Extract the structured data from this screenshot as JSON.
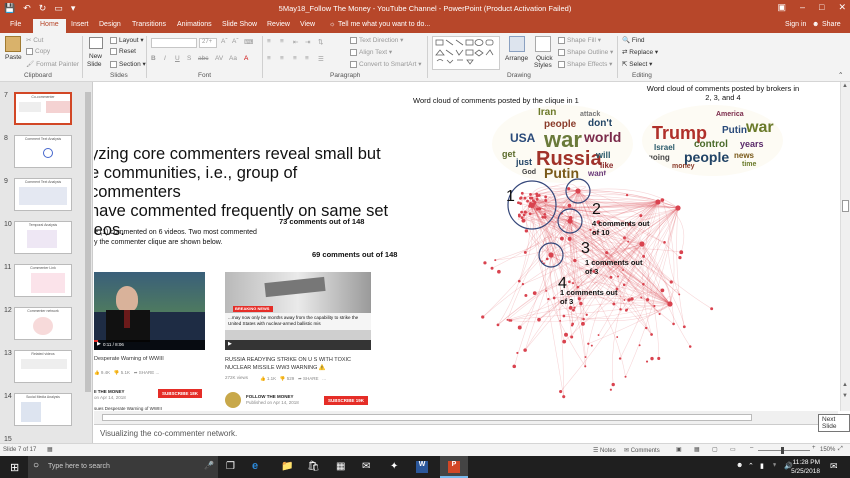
{
  "window": {
    "title": "5May18_Follow The Money - YouTube Channel - PowerPoint (Product Activation Failed)",
    "signin": "Sign in",
    "share": "Share"
  },
  "tabs": [
    "File",
    "Home",
    "Insert",
    "Design",
    "Transitions",
    "Animations",
    "Slide Show",
    "Review",
    "View"
  ],
  "tell_me": "Tell me what you want to do...",
  "ribbon": {
    "clipboard": {
      "paste": "Paste",
      "cut": "Cut",
      "copy": "Copy",
      "format_painter": "Format Painter",
      "label": "Clipboard"
    },
    "slides": {
      "new_slide": "New",
      "new_slide2": "Slide",
      "layout": "Layout",
      "reset": "Reset",
      "section": "Section",
      "label": "Slides"
    },
    "font": {
      "label": "Font",
      "size": "27+"
    },
    "paragraph": {
      "text_direction": "Text Direction",
      "align_text": "Align Text",
      "smartart": "Convert to SmartArt",
      "label": "Paragraph"
    },
    "drawing": {
      "arrange": "Arrange",
      "quick_styles": "Quick",
      "quick_styles2": "Styles",
      "shape_fill": "Shape Fill",
      "shape_outline": "Shape Outline",
      "shape_effects": "Shape Effects",
      "label": "Drawing"
    },
    "editing": {
      "find": "Find",
      "replace": "Replace",
      "select": "Select",
      "label": "Editing"
    }
  },
  "thumbs": [
    {
      "num": "7",
      "title": "Co-commenter"
    },
    {
      "num": "8",
      "title": "Comment Text Analysis"
    },
    {
      "num": "9",
      "title": "Comment Text Analysis"
    },
    {
      "num": "10",
      "title": "Temporal Analysis"
    },
    {
      "num": "11",
      "title": "Commenter Link"
    },
    {
      "num": "12",
      "title": "Commenter network"
    },
    {
      "num": "13",
      "title": "Related videos"
    },
    {
      "num": "14",
      "title": "Social Media Analysis"
    },
    {
      "num": "15",
      "title": ""
    }
  ],
  "slide": {
    "heading_lines": [
      "yzing core commenters reveal small but",
      "e communities, i.e., group of commenters",
      "have commented frequently on same set",
      "leos."
    ],
    "body_line1": "e (1) commented on 6 videos. Two most commented",
    "body_line2": "y the commenter clique are shown below.",
    "stat1": "73 comments out of 148",
    "stat2": "69 comments out of 148",
    "wordcloud1_title": "Word cloud of comments posted by the clique in 1",
    "wordcloud2_title_l1": "Word cloud of comments posted by brokers in",
    "wordcloud2_title_l2": "2, 3, and 4",
    "video1": {
      "time": "0:11 / 8:06",
      "title": "Desperate Warning of WWIII",
      "views": "9.4K",
      "likes": "5.1K",
      "share": "SHARE",
      "channel": "II THE MONEY",
      "published": "on Apr 14, 2018",
      "subscribe": "SUBSCRIBE 18K",
      "caption": "sues Desperate Warning of WWIII"
    },
    "video2": {
      "breaking": "BREAKING NEWS",
      "ticker": "...may now only be months away from the capability to strike the United States with nuclear-armed ballistic mis",
      "title": "RUSSIA READYING STRIKE ON U S WITH TOXIC NUCLEAR MISSILE WW3 WARNING ⚠️",
      "views": "272K views",
      "likes": "1.1K",
      "dislikes": "529",
      "share": "SHARE",
      "channel": "FOLLOW THE MONEY",
      "published": "Published on Apr 14, 2018",
      "subscribe": "SUBSCRIBE 19K"
    },
    "net_labels": {
      "n1": "1",
      "n2": "2",
      "n3": "3",
      "n4": "4",
      "t2a": "4 comments out",
      "t2b": "of 10",
      "t3a": "1 comments out",
      "t3b": "of 3",
      "t4a": "1 comments out",
      "t4b": "of 3"
    },
    "words1": [
      "Iran",
      "people",
      "don't",
      "war",
      "world",
      "USA",
      "Russia",
      "Putin",
      "get",
      "just",
      "will",
      "like",
      "want",
      "God",
      "attack"
    ],
    "words2": [
      "Trump",
      "war",
      "Putin",
      "people",
      "America",
      "control",
      "money",
      "years",
      "Israel",
      "going",
      "news",
      "time"
    ]
  },
  "notes": "Visualizing the co-commenter network.",
  "status": {
    "slide_of": "Slide 7 of 17",
    "notes": "Notes",
    "comments": "Comments",
    "zoom": "150%"
  },
  "tooltip": "Next Slide",
  "taskbar": {
    "search": "Type here to search",
    "time": "11:28 PM",
    "date": "5/25/2018"
  },
  "colors": {
    "accent": "#b7472a",
    "network": "#d9434f",
    "youtube_red": "#e52d27"
  }
}
